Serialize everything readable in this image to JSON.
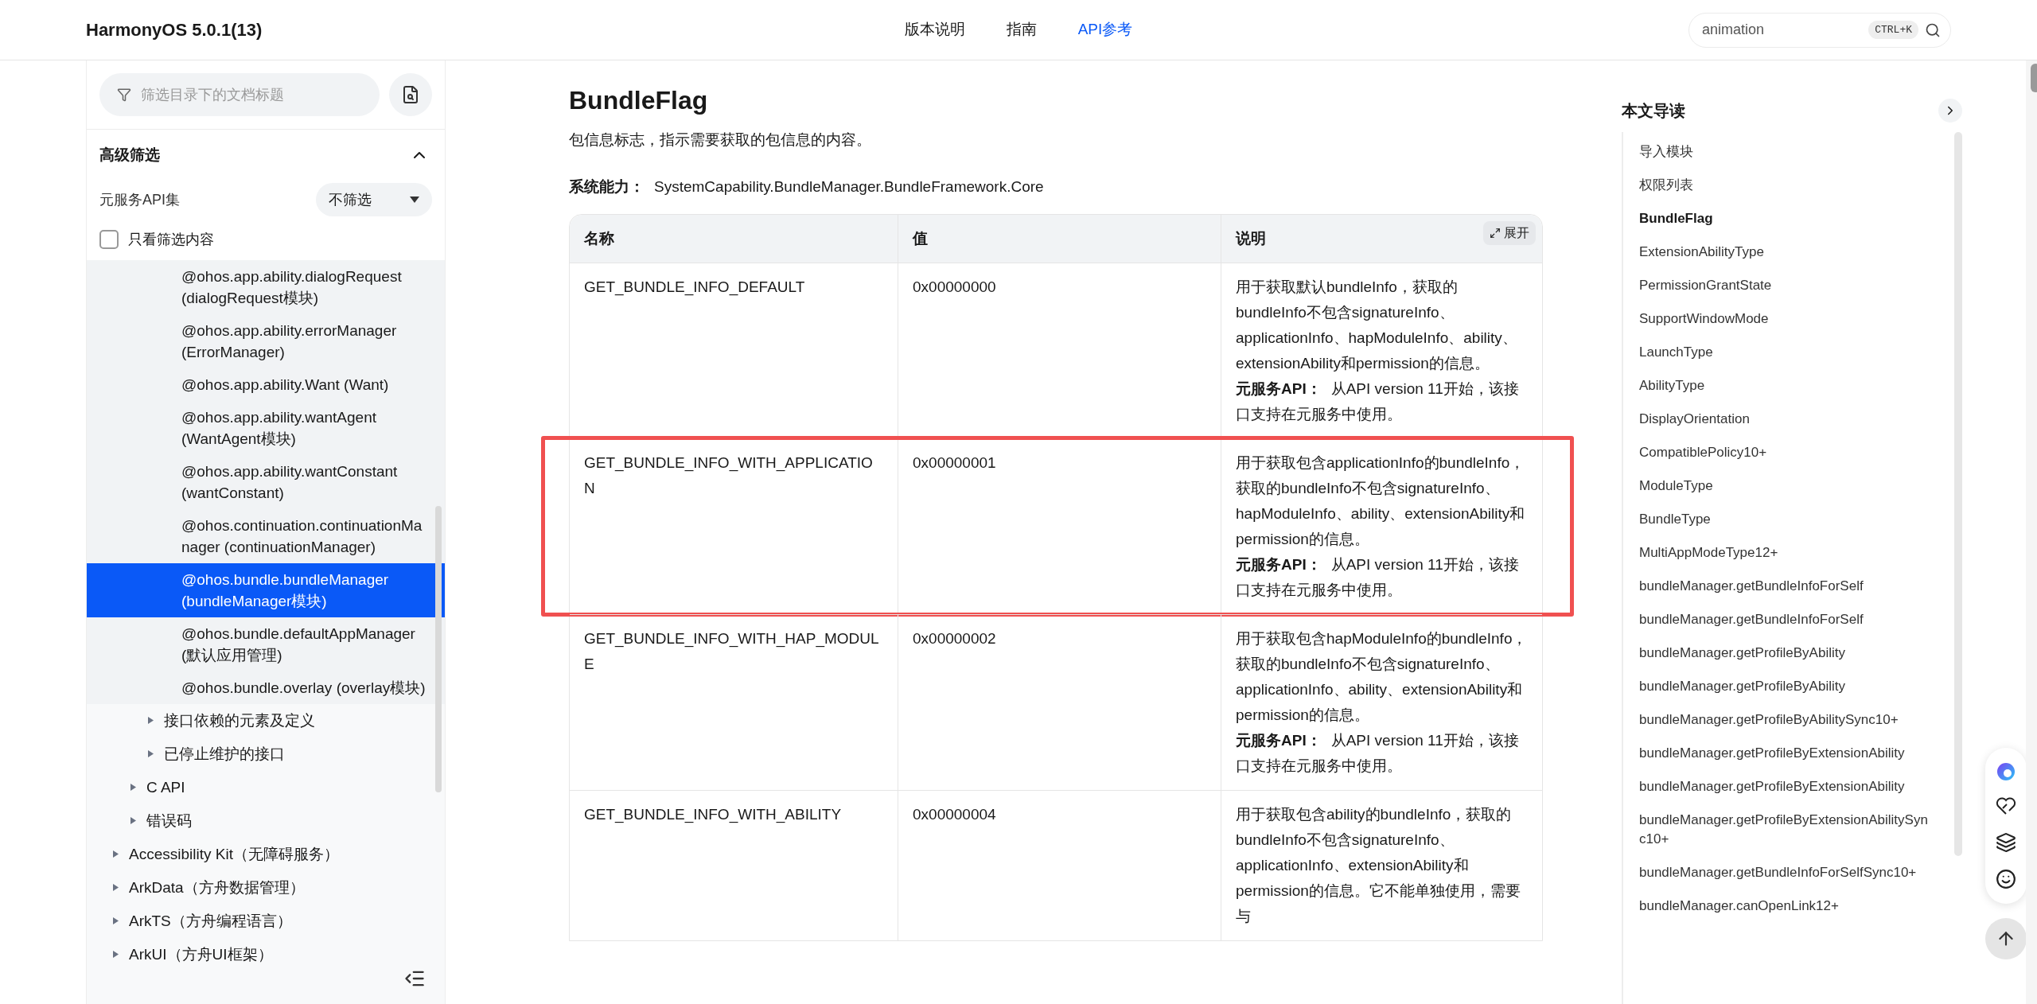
{
  "header": {
    "title": "HarmonyOS 5.0.1(13)",
    "nav": [
      {
        "label": "版本说明",
        "selected": false
      },
      {
        "label": "指南",
        "selected": false
      },
      {
        "label": "API参考",
        "selected": true
      }
    ],
    "search": {
      "value": "animation",
      "shortcut": "CTRL+K"
    }
  },
  "sidebar": {
    "filter": {
      "placeholder": "筛选目录下的文档标题"
    },
    "advanced": {
      "title": "高级筛选",
      "expanded": true,
      "api_set": {
        "label": "元服务API集",
        "value": "不筛选"
      },
      "only_filtered": {
        "label": "只看筛选内容",
        "checked": false
      }
    },
    "tree": [
      {
        "children": [
          {
            "children": [
              {
                "children": [
                  {
                    "label": "@ohos.app.ability.dialogRequest (dialogRequest模块)",
                    "selected": false
                  },
                  {
                    "label": "@ohos.app.ability.errorManager (ErrorManager)",
                    "selected": false
                  },
                  {
                    "label": "@ohos.app.ability.Want (Want)",
                    "selected": false
                  },
                  {
                    "label": "@ohos.app.ability.wantAgent (WantAgent模块)",
                    "selected": false
                  },
                  {
                    "label": "@ohos.app.ability.wantConstant (wantConstant)",
                    "selected": false
                  },
                  {
                    "label": "@ohos.continuation.continuationManager (continuationManager)",
                    "selected": false
                  },
                  {
                    "label": "@ohos.bundle.bundleManager (bundleManager模块)",
                    "selected": true
                  },
                  {
                    "label": "@ohos.bundle.defaultAppManager (默认应用管理)",
                    "selected": false
                  },
                  {
                    "label": "@ohos.bundle.overlay (overlay模块)",
                    "selected": false
                  }
                ]
              },
              {
                "label": "接口依赖的元素及定义",
                "selected": false,
                "expanded": false
              },
              {
                "label": "已停止维护的接口",
                "selected": false,
                "expanded": false
              }
            ]
          },
          {
            "label": "C API",
            "selected": false,
            "expanded": false
          },
          {
            "label": "错误码",
            "selected": false,
            "expanded": false
          }
        ]
      },
      {
        "label": "Accessibility Kit（无障碍服务）",
        "selected": false,
        "expanded": false
      },
      {
        "label": "ArkData（方舟数据管理）",
        "selected": false,
        "expanded": false
      },
      {
        "label": "ArkTS（方舟编程语言）",
        "selected": false,
        "expanded": false
      },
      {
        "label": "ArkUI（方舟UI框架）",
        "selected": false,
        "expanded": false
      }
    ]
  },
  "article": {
    "title": "BundleFlag",
    "intro": "包信息标志，指示需要获取的包信息的内容。",
    "capability": {
      "label": "系统能力：",
      "value": "SystemCapability.BundleManager.BundleFramework.Core"
    },
    "table": {
      "expand_button": "展开",
      "columns": [
        "名称",
        "值",
        "说明"
      ],
      "rows": [
        {
          "name": "GET_BUNDLE_INFO_DEFAULT",
          "value": "0x00000000",
          "description": "用于获取默认bundleInfo，获取的bundleInfo不包含signatureInfo、applicationInfo、hapModuleInfo、ability、extensionAbility和permission的信息。",
          "api_label": "元服务API：",
          "api_note": "从API version 11开始，该接口支持在元服务中使用。",
          "highlighted": false
        },
        {
          "name": "GET_BUNDLE_INFO_WITH_APPLICATION",
          "value": "0x00000001",
          "description": "用于获取包含applicationInfo的bundleInfo，获取的bundleInfo不包含signatureInfo、hapModuleInfo、ability、extensionAbility和permission的信息。",
          "api_label": "元服务API：",
          "api_note": "从API version 11开始，该接口支持在元服务中使用。",
          "highlighted": true
        },
        {
          "name": "GET_BUNDLE_INFO_WITH_HAP_MODULE",
          "value": "0x00000002",
          "description": "用于获取包含hapModuleInfo的bundleInfo，获取的bundleInfo不包含signatureInfo、applicationInfo、ability、extensionAbility和permission的信息。",
          "api_label": "元服务API：",
          "api_note": "从API version 11开始，该接口支持在元服务中使用。",
          "highlighted": false
        },
        {
          "name": "GET_BUNDLE_INFO_WITH_ABILITY",
          "value": "0x00000004",
          "description": "用于获取包含ability的bundleInfo，获取的bundleInfo不包含signatureInfo、applicationInfo、extensionAbility和permission的信息。它不能单独使用，需要与",
          "highlighted": false
        }
      ]
    }
  },
  "toc": {
    "title": "本文导读",
    "items": [
      {
        "label": "导入模块",
        "selected": false
      },
      {
        "label": "权限列表",
        "selected": false
      },
      {
        "label": "BundleFlag",
        "selected": true
      },
      {
        "label": "ExtensionAbilityType",
        "selected": false
      },
      {
        "label": "PermissionGrantState",
        "selected": false
      },
      {
        "label": "SupportWindowMode",
        "selected": false
      },
      {
        "label": "LaunchType",
        "selected": false
      },
      {
        "label": "AbilityType",
        "selected": false
      },
      {
        "label": "DisplayOrientation",
        "selected": false
      },
      {
        "label": "CompatiblePolicy10+",
        "selected": false
      },
      {
        "label": "ModuleType",
        "selected": false
      },
      {
        "label": "BundleType",
        "selected": false
      },
      {
        "label": "MultiAppModeType12+",
        "selected": false
      },
      {
        "label": "bundleManager.getBundleInfoForSelf",
        "selected": false
      },
      {
        "label": "bundleManager.getBundleInfoForSelf",
        "selected": false
      },
      {
        "label": "bundleManager.getProfileByAbility",
        "selected": false
      },
      {
        "label": "bundleManager.getProfileByAbility",
        "selected": false
      },
      {
        "label": "bundleManager.getProfileByAbilitySync10+",
        "selected": false
      },
      {
        "label": "bundleManager.getProfileByExtensionAbility",
        "selected": false
      },
      {
        "label": "bundleManager.getProfileByExtensionAbility",
        "selected": false
      },
      {
        "label": "bundleManager.getProfileByExtensionAbilitySync10+",
        "selected": false
      },
      {
        "label": "bundleManager.getBundleInfoForSelfSync10+",
        "selected": false
      },
      {
        "label": "bundleManager.canOpenLink12+",
        "selected": false
      }
    ]
  }
}
